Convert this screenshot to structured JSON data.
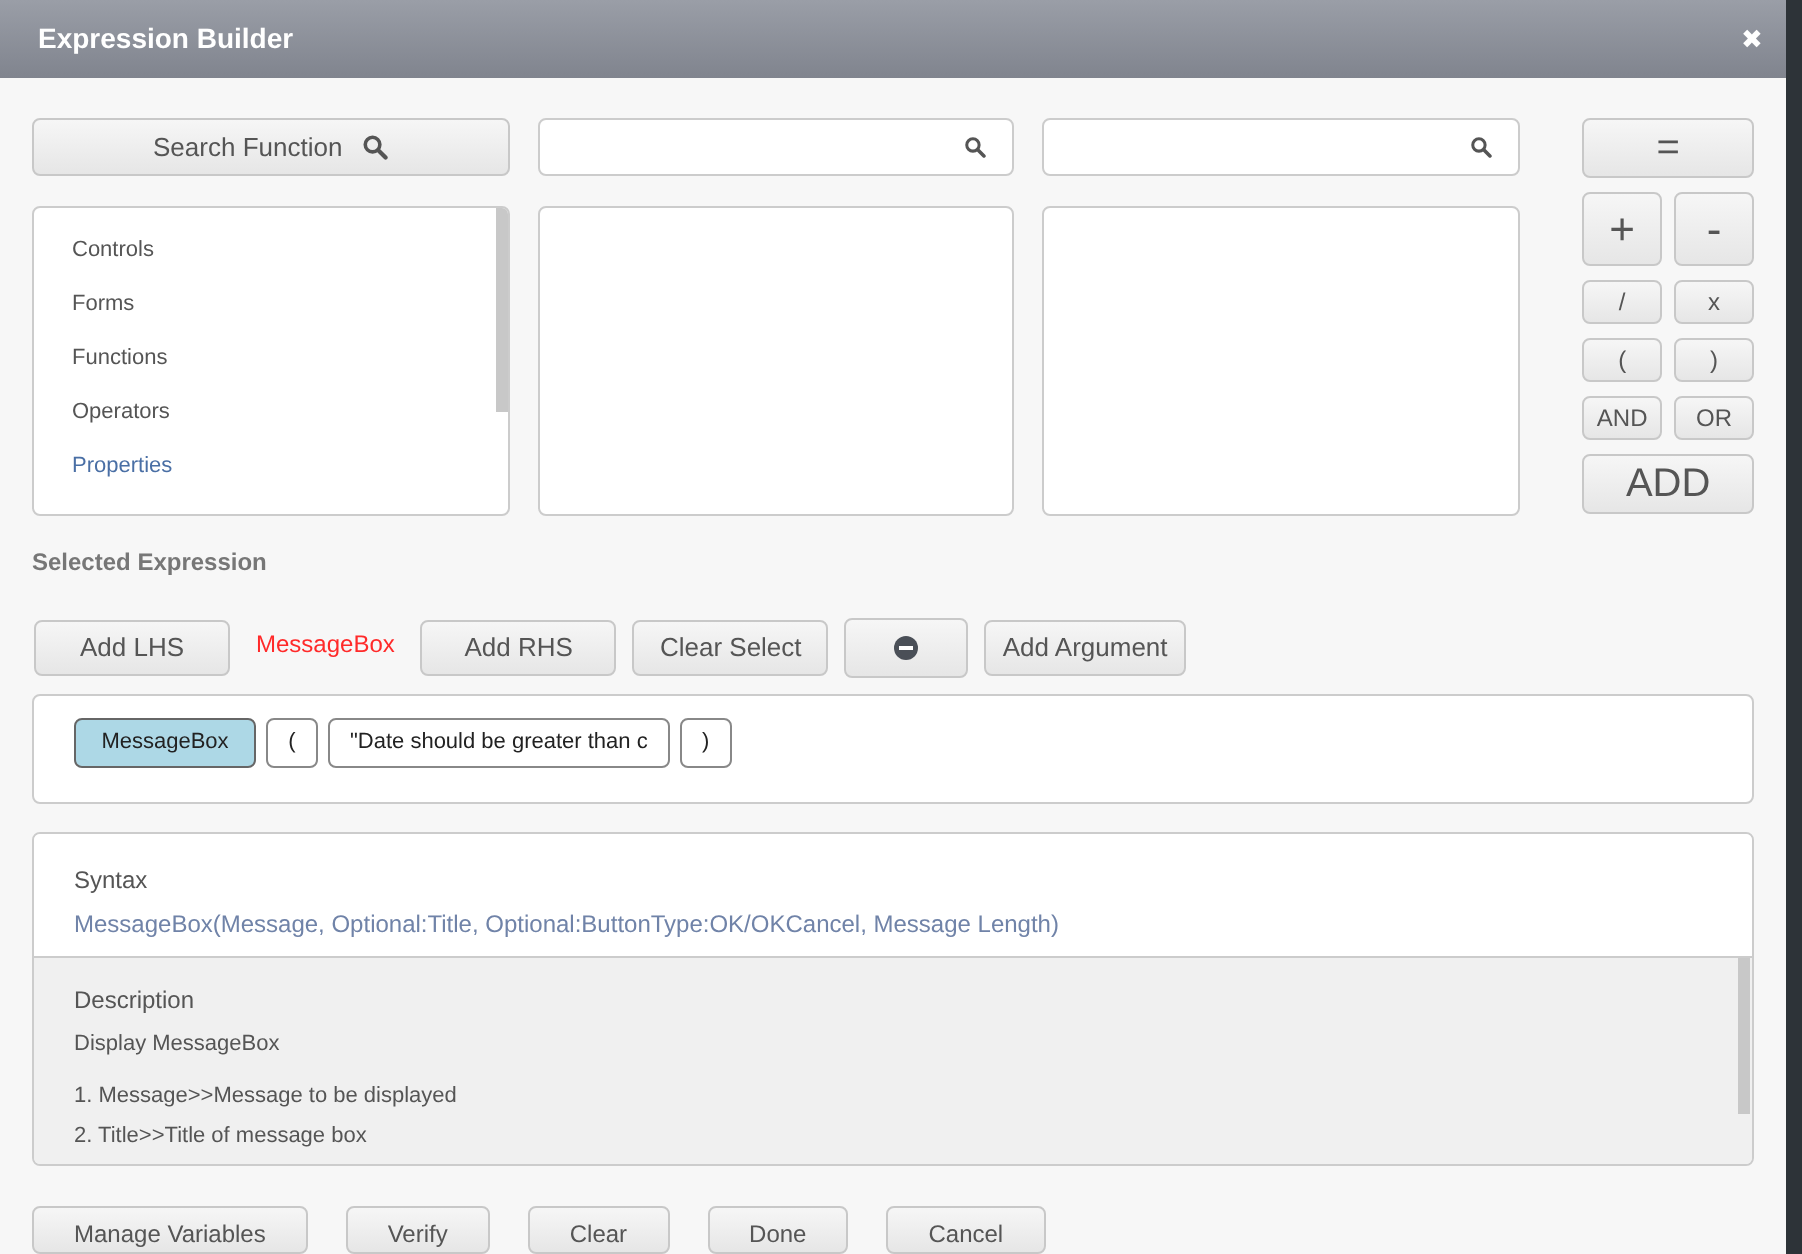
{
  "window": {
    "title": "Expression Builder",
    "close": "✖"
  },
  "search_button": {
    "label": "Search Function"
  },
  "categories": [
    {
      "label": "Controls",
      "selected": false
    },
    {
      "label": "Forms",
      "selected": false
    },
    {
      "label": "Functions",
      "selected": false
    },
    {
      "label": "Operators",
      "selected": false
    },
    {
      "label": "Properties",
      "selected": true
    }
  ],
  "operators": [
    {
      "label": "=",
      "kind": "wide"
    },
    {
      "label": "+",
      "kind": "large"
    },
    {
      "label": "-",
      "kind": "large"
    },
    {
      "label": "/",
      "kind": "small"
    },
    {
      "label": "x",
      "kind": "small"
    },
    {
      "label": "(",
      "kind": "small"
    },
    {
      "label": ")",
      "kind": "small"
    },
    {
      "label": "AND",
      "kind": "small"
    },
    {
      "label": "OR",
      "kind": "small"
    },
    {
      "label": "ADD",
      "kind": "wide"
    }
  ],
  "selected_expression_label": "Selected Expression",
  "expression_toolbar": [
    {
      "kind": "button",
      "label": "Add LHS"
    },
    {
      "kind": "text",
      "label": "MessageBox"
    },
    {
      "kind": "button",
      "label": "Add RHS"
    },
    {
      "kind": "button",
      "label": "Clear Select"
    },
    {
      "kind": "remove"
    },
    {
      "kind": "button",
      "label": "Add Argument"
    }
  ],
  "tokens": [
    {
      "kind": "function",
      "text": "MessageBox",
      "selected": true
    },
    {
      "kind": "paren",
      "text": "(",
      "selected": false
    },
    {
      "kind": "argument",
      "text": "\"Date should be greater than c",
      "selected": false
    },
    {
      "kind": "paren",
      "text": ")",
      "selected": false
    }
  ],
  "syntax": {
    "label": "Syntax",
    "text": "MessageBox(Message, Optional:Title, Optional:ButtonType:OK/OKCancel, Message Length)"
  },
  "description": {
    "label": "Description",
    "summary": "Display MessageBox",
    "lines": [
      "1. Message>>Message to be displayed",
      "2. Title>>Title of message box"
    ]
  },
  "footer_buttons": [
    "Manage Variables",
    "Verify",
    "Clear",
    "Done",
    "Cancel"
  ]
}
